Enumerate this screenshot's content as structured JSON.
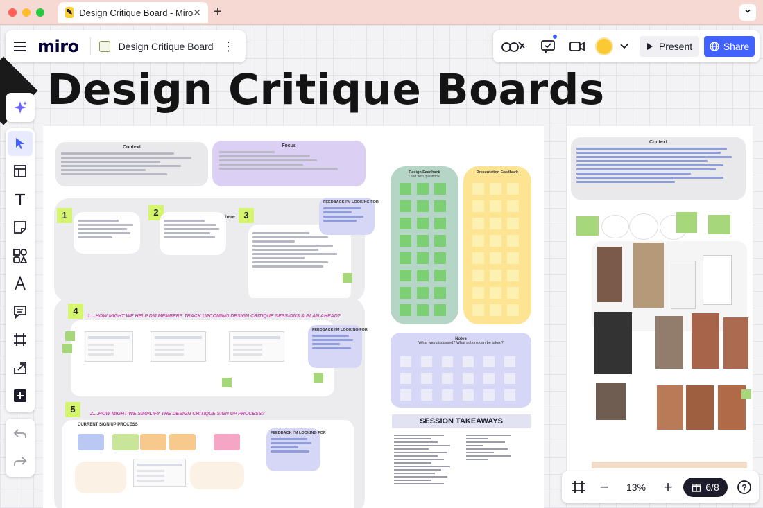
{
  "browser": {
    "tab_title": "Design Critique Board - Miro",
    "tab_favicon": "miro-favicon",
    "new_tab": "+",
    "tab_close": "✕",
    "menu_icon": "chevron-down-icon"
  },
  "header": {
    "logo": "miro",
    "board_name": "Design Critique Board",
    "present_label": "Present",
    "share_label": "Share",
    "accent_color": "#4262ff"
  },
  "board": {
    "title": "Design Critique Boards",
    "main_frame": {
      "context_title": "Context",
      "focus_title": "Focus",
      "section_numbers": [
        "1",
        "2",
        "3",
        "4",
        "5"
      ],
      "here_label": "here",
      "feedback_label": "FEEDBACK I'M LOOKING FOR",
      "section4_heading": "1....HOW MIGHT WE HELP DM MEMBERS TRACK UPCOMING DESIGN CRITIQUE SESSIONS & PLAN AHEAD?",
      "section5_heading": "2....HOW MIGHT WE SIMPLIFY THE DESIGN CRITIQUE SIGN UP PROCESS?",
      "current_signup": "CURRENT SIGN UP PROCESS",
      "design_feedback_title": "Design Feedback",
      "design_feedback_sub": "Lead with questions!",
      "presentation_feedback_title": "Presentation Feedback",
      "notes_title": "Notes",
      "notes_sub": "What was discussed? What actions can be taken?",
      "session_takeaways": "SESSION TAKEAWAYS"
    },
    "right_frame": {
      "context_title": "Context"
    },
    "colors": {
      "lime_badge": "#d5f56e",
      "focus_purple": "#dccff4",
      "feedback_green": "#b5d5c7",
      "feedback_yellow": "#fde493",
      "notes_lavender": "#d6d6f7"
    }
  },
  "toolbar": {
    "ai_icon": "sparkles-icon",
    "tools": [
      "select-tool",
      "templates-tool",
      "text-tool",
      "sticky-note-tool",
      "shapes-tool",
      "pen-tool",
      "comment-tool",
      "frame-tool",
      "upload-tool",
      "more-tools"
    ],
    "undo": "undo-icon",
    "redo": "redo-icon"
  },
  "zoom": {
    "level": "13%",
    "frames_count": "6/8",
    "minus": "−",
    "plus": "+",
    "help": "?"
  }
}
